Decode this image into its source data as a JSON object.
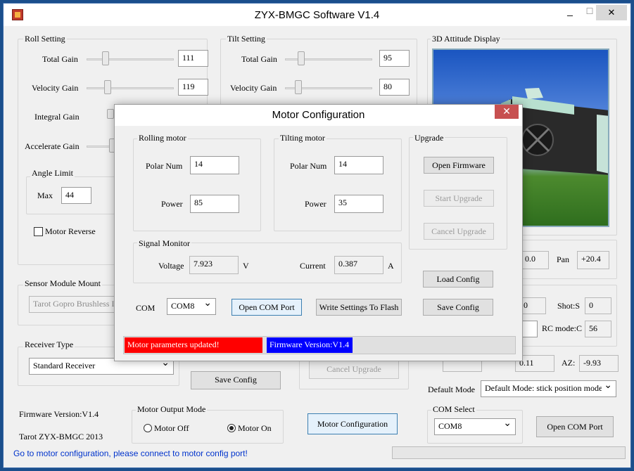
{
  "window": {
    "title": "ZYX-BMGC Software V1.4",
    "minimize": "_",
    "maximize": "☐",
    "close": "✕"
  },
  "roll": {
    "title": "Roll Setting",
    "total_gain_label": "Total Gain",
    "total_gain": "111",
    "velocity_gain_label": "Velocity Gain",
    "velocity_gain": "119",
    "integral_gain_label": "Integral Gain",
    "accelerate_gain_label": "Accelerate Gain",
    "angle_limit_title": "Angle Limit",
    "max_label": "Max",
    "max_value": "44",
    "motor_reverse_label": "Motor Reverse"
  },
  "tilt": {
    "title": "Tilt Setting",
    "total_gain_label": "Total Gain",
    "total_gain": "95",
    "velocity_gain_label": "Velocity Gain",
    "velocity_gain": "80"
  },
  "attitude": {
    "title": "3D Attitude Display",
    "partial_value": "0.0",
    "pan_label": "Pan",
    "pan_value": "+20.4"
  },
  "sensor": {
    "title": "Sensor Module Mount",
    "selected": "Tarot Gopro Brushless I"
  },
  "receiver": {
    "title": "Receiver Type",
    "selected": "Standard Receiver"
  },
  "mid": {
    "partial_value": "0",
    "shots_label": "Shot:S",
    "shots_value": "0",
    "rcmode_label": "RC mode:C",
    "rcmode_value": "56",
    "partial_value2": "0.11",
    "az_label": "AZ:",
    "az_value": "-9.93"
  },
  "main_save_config": "Save Config",
  "main_cancel_upgrade": "Cancel Upgrade",
  "default_mode": {
    "label": "Default Mode",
    "selected": "Default Mode: stick position mode"
  },
  "firmware_version": "Firmware Version:V1.4",
  "copyright": "Tarot ZYX-BMGC 2013",
  "motor_output": {
    "title": "Motor Output Mode",
    "off_label": "Motor Off",
    "on_label": "Motor On",
    "selected": "on"
  },
  "motor_config_button": "Motor Configuration",
  "com_select": {
    "title": "COM Select",
    "selected": "COM8",
    "open_button": "Open COM Port"
  },
  "status_bar": {
    "message": "Go to motor configuration, please connect to motor config port!"
  },
  "dialog": {
    "title": "Motor Configuration",
    "close": "✕",
    "rolling": {
      "title": "Rolling motor",
      "polar_label": "Polar Num",
      "polar_value": "14",
      "power_label": "Power",
      "power_value": "85"
    },
    "tilting": {
      "title": "Tilting motor",
      "polar_label": "Polar Num",
      "polar_value": "14",
      "power_label": "Power",
      "power_value": "35"
    },
    "upgrade": {
      "title": "Upgrade",
      "open_firmware": "Open Firmware",
      "start_upgrade": "Start Upgrade",
      "cancel_upgrade": "Cancel Upgrade"
    },
    "signal": {
      "title": "Signal Monitor",
      "voltage_label": "Voltage",
      "voltage_value": "7.923",
      "voltage_unit": "V",
      "current_label": "Current",
      "current_value": "0.387",
      "current_unit": "A"
    },
    "load_config": "Load Config",
    "save_config": "Save Config",
    "com_label": "COM",
    "com_selected": "COM8",
    "open_com_port": "Open COM Port",
    "write_flash": "Write Settings To Flash",
    "status_msg": "Motor parameters updated!",
    "firmware_msg": "Firmware Version:V1.4",
    "colors": {
      "status_red": "#ff0000",
      "firmware_blue": "#0000ff"
    }
  }
}
